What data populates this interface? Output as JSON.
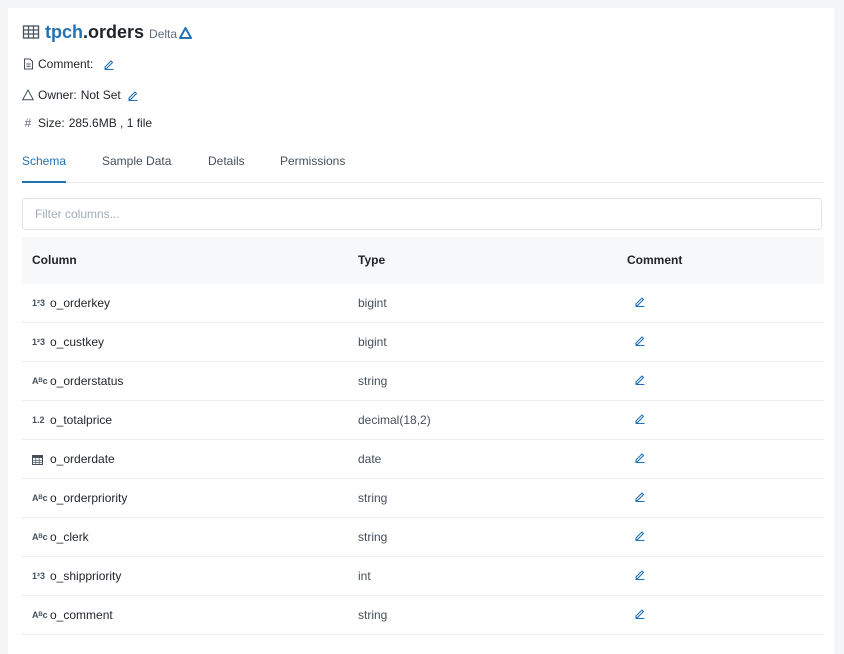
{
  "header": {
    "schema": "tpch",
    "dot": ".",
    "table": "orders",
    "format": "Delta"
  },
  "meta": {
    "comment_label": "Comment:",
    "owner_label": "Owner:",
    "owner_value": "Not Set",
    "size_label": "Size:",
    "size_value": "285.6MB , 1 file"
  },
  "tabs": [
    "Schema",
    "Sample Data",
    "Details",
    "Permissions"
  ],
  "filter": {
    "placeholder": "Filter columns..."
  },
  "table": {
    "headers": {
      "column": "Column",
      "type": "Type",
      "comment": "Comment"
    },
    "rows": [
      {
        "icon": "integer-icon",
        "icon_text": "1²3",
        "name": "o_orderkey",
        "type": "bigint"
      },
      {
        "icon": "integer-icon",
        "icon_text": "1²3",
        "name": "o_custkey",
        "type": "bigint"
      },
      {
        "icon": "string-icon",
        "icon_text": "A͏ᴮc",
        "name": "o_orderstatus",
        "type": "string"
      },
      {
        "icon": "decimal-icon",
        "icon_text": "1.2",
        "name": "o_totalprice",
        "type": "decimal(18,2)"
      },
      {
        "icon": "calendar-icon",
        "icon_text": "",
        "name": "o_orderdate",
        "type": "date"
      },
      {
        "icon": "string-icon",
        "icon_text": "A͏ᴮc",
        "name": "o_orderpriority",
        "type": "string"
      },
      {
        "icon": "string-icon",
        "icon_text": "A͏ᴮc",
        "name": "o_clerk",
        "type": "string"
      },
      {
        "icon": "integer-icon",
        "icon_text": "1²3",
        "name": "o_shippriority",
        "type": "int"
      },
      {
        "icon": "string-icon",
        "icon_text": "A͏ᴮc",
        "name": "o_comment",
        "type": "string"
      }
    ]
  },
  "colors": {
    "accent": "#2272b4",
    "header_bg": "#f7f8f9",
    "border": "#ebedf0"
  }
}
